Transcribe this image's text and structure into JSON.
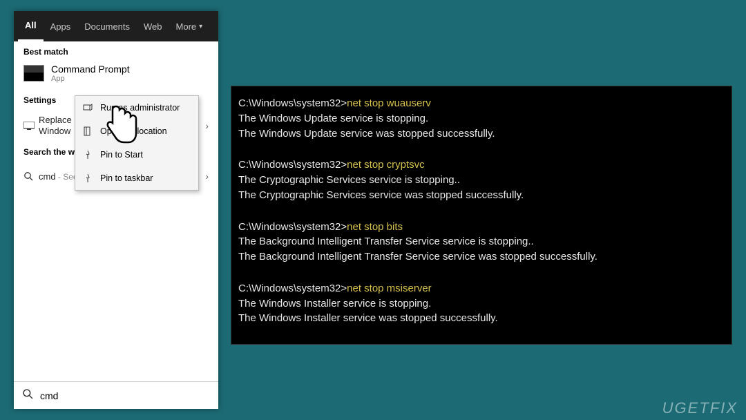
{
  "tabs": {
    "all": "All",
    "apps": "Apps",
    "documents": "Documents",
    "web": "Web",
    "more": "More"
  },
  "sections": {
    "best_match": "Best match",
    "settings": "Settings",
    "search_web": "Search the web"
  },
  "best_match": {
    "title": "Command Prompt",
    "subtitle": "App"
  },
  "settings_row": {
    "label_line1": "Replace",
    "label_line2": "Window",
    "trail": "X"
  },
  "web_row": {
    "query": "cmd",
    "suffix": " - See web results"
  },
  "context_menu": {
    "run_admin": "Run as administrator",
    "open_loc": "Open file location",
    "pin_start": "Pin to Start",
    "pin_taskbar": "Pin to taskbar"
  },
  "search_input": {
    "value": "cmd"
  },
  "terminal": {
    "prompt": "C:\\Windows\\system32>",
    "blocks": [
      {
        "cmd": "net stop wuauserv",
        "lines": [
          "The Windows Update service is stopping.",
          "The Windows Update service was stopped successfully."
        ]
      },
      {
        "cmd": "net stop cryptsvc",
        "lines": [
          "The Cryptographic Services service is stopping..",
          "The Cryptographic Services service was stopped successfully."
        ]
      },
      {
        "cmd": "net stop bits",
        "lines": [
          "The Background Intelligent Transfer Service service is stopping..",
          "The Background Intelligent Transfer Service service was stopped successfully."
        ]
      },
      {
        "cmd": "net stop msiserver",
        "lines": [
          "The Windows Installer service is stopping.",
          "The Windows Installer service was stopped successfully."
        ]
      }
    ]
  },
  "watermark": "UGETFIX"
}
